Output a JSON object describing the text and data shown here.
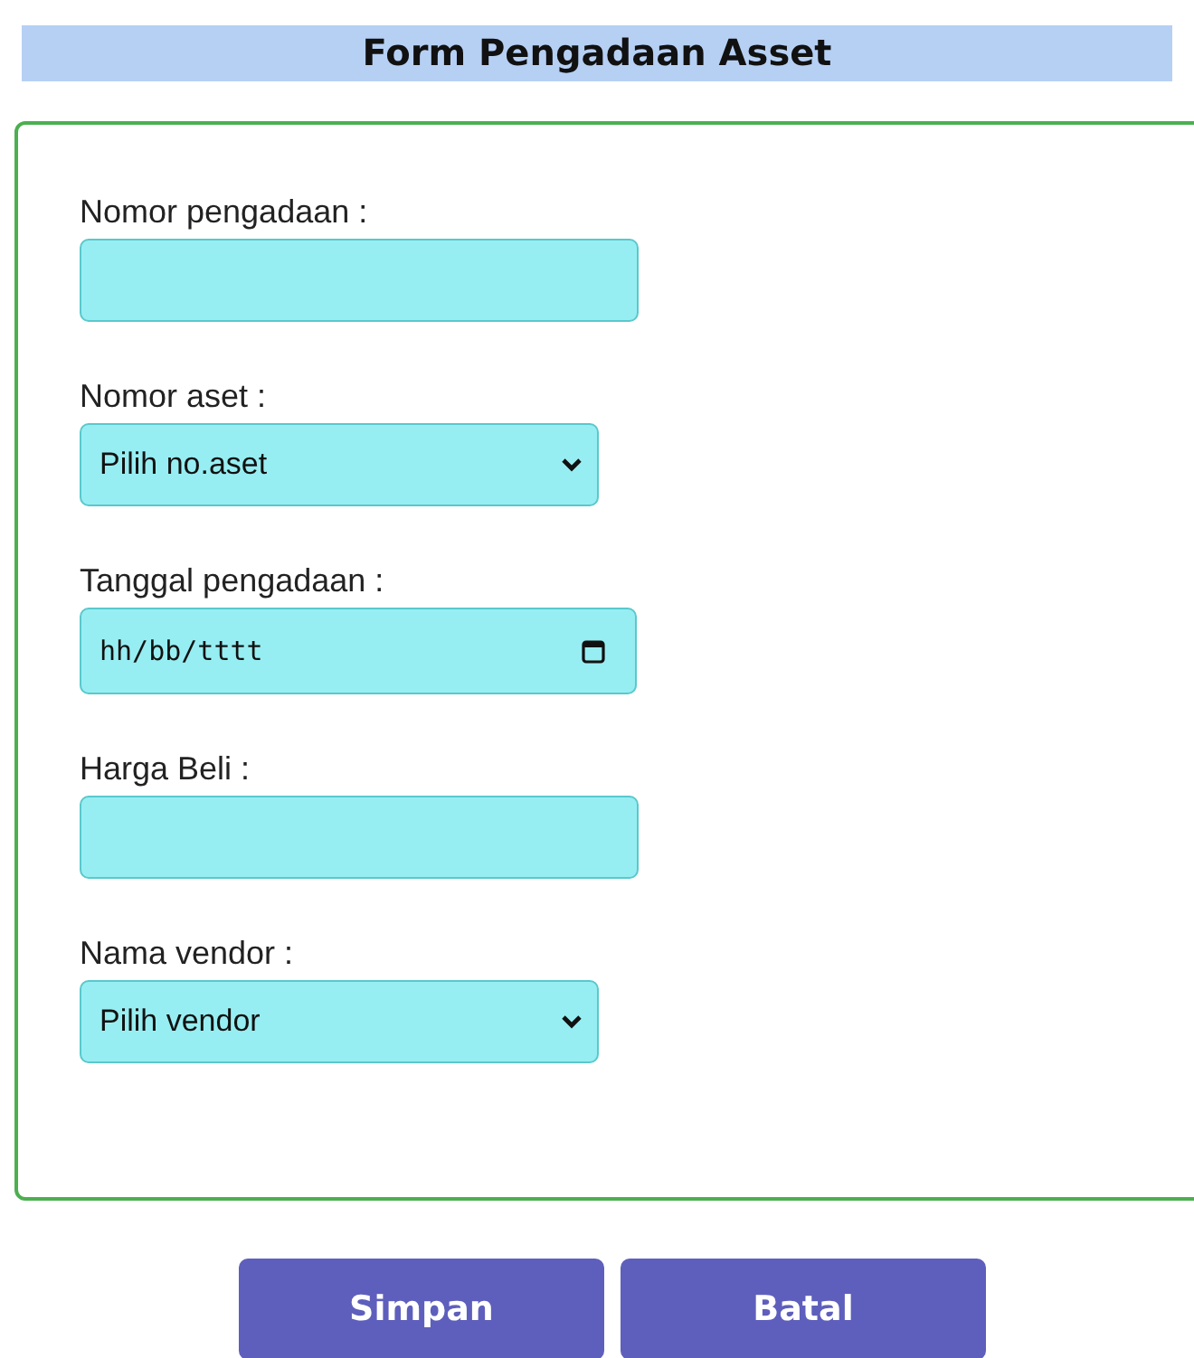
{
  "title": "Form Pengadaan Asset",
  "fields": [
    {
      "label": "Nomor pengadaan :",
      "kind": "text"
    },
    {
      "label": "Nomor aset :",
      "kind": "select",
      "value": "Pilih no.aset"
    },
    {
      "label": "Tanggal pengadaan :",
      "kind": "date",
      "value": "hh/bb/tttt"
    },
    {
      "label": "Harga Beli :",
      "kind": "text"
    },
    {
      "label": "Nama vendor :",
      "kind": "select",
      "value": "Pilih vendor"
    }
  ],
  "buttons": [
    "Simpan",
    "Batal"
  ]
}
